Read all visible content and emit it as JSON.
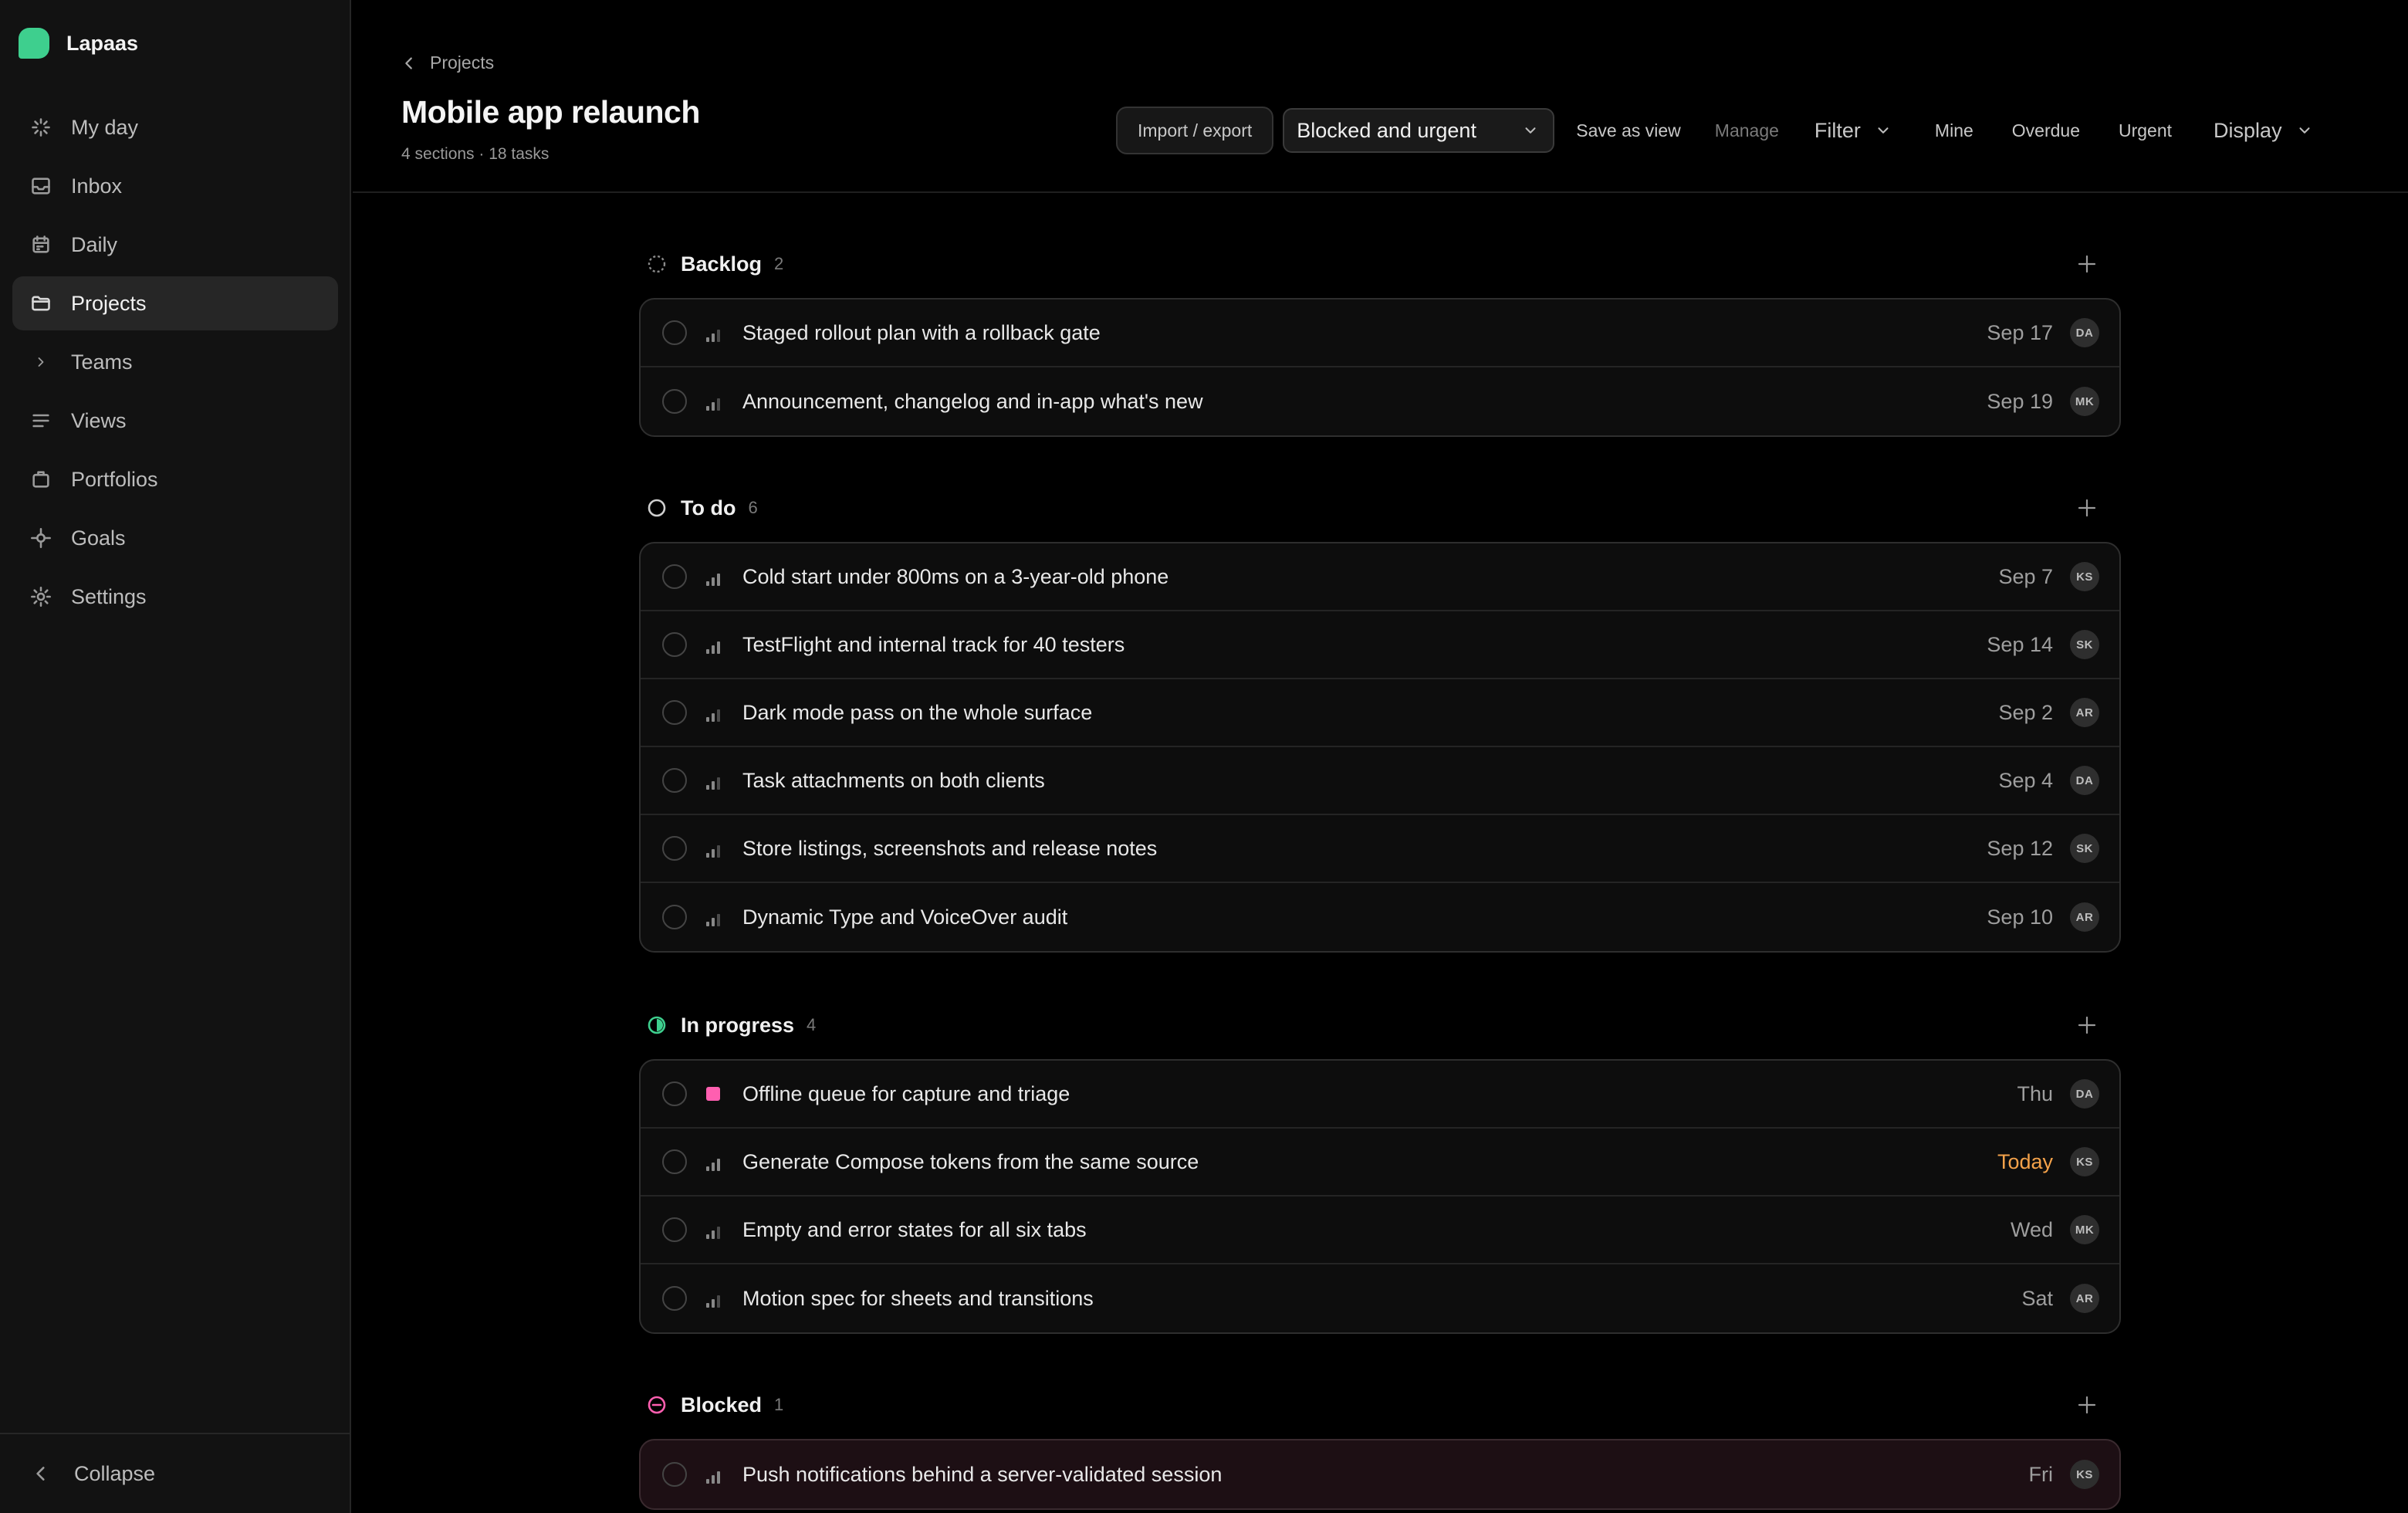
{
  "app": {
    "name": "Lapaas",
    "brand_color": "#3ecf8e"
  },
  "sidebar": {
    "items": [
      {
        "label": "My day",
        "icon": "sparkle-icon",
        "active": false
      },
      {
        "label": "Inbox",
        "icon": "inbox-icon",
        "active": false
      },
      {
        "label": "Daily",
        "icon": "calendar-icon",
        "active": false
      },
      {
        "label": "Projects",
        "icon": "folder-icon",
        "active": true
      },
      {
        "label": "Teams",
        "icon": "chevron-right-icon",
        "active": false
      },
      {
        "label": "Views",
        "icon": "list-icon",
        "active": false
      },
      {
        "label": "Portfolios",
        "icon": "briefcase-icon",
        "active": false
      },
      {
        "label": "Goals",
        "icon": "target-icon",
        "active": false
      },
      {
        "label": "Settings",
        "icon": "gear-icon",
        "active": false
      }
    ],
    "collapse_label": "Collapse"
  },
  "header": {
    "breadcrumb": "Projects",
    "title": "Mobile app relaunch",
    "subtitle": "4 sections · 18 tasks",
    "toolbar": {
      "import_export": "Import / export",
      "view_select": "Blocked and urgent",
      "save_as_view": "Save as view",
      "manage": "Manage",
      "filter": "Filter",
      "mine": "Mine",
      "overdue": "Overdue",
      "urgent": "Urgent",
      "display": "Display"
    }
  },
  "sections": [
    {
      "title": "Backlog",
      "count": "2",
      "status": "backlog",
      "tasks": [
        {
          "title": "Staged rollout plan with a rollback gate",
          "due": "Sep 17",
          "assignee": "DA",
          "priority": "low"
        },
        {
          "title": "Announcement, changelog and in-app what's new",
          "due": "Sep 19",
          "assignee": "MK",
          "priority": "low"
        }
      ]
    },
    {
      "title": "To do",
      "count": "6",
      "status": "todo",
      "tasks": [
        {
          "title": "Cold start under 800ms on a 3-year-old phone",
          "due": "Sep 7",
          "assignee": "KS",
          "priority": "high"
        },
        {
          "title": "TestFlight and internal track for 40 testers",
          "due": "Sep 14",
          "assignee": "SK",
          "priority": "high"
        },
        {
          "title": "Dark mode pass on the whole surface",
          "due": "Sep 2",
          "assignee": "AR",
          "priority": "medium"
        },
        {
          "title": "Task attachments on both clients",
          "due": "Sep 4",
          "assignee": "DA",
          "priority": "medium"
        },
        {
          "title": "Store listings, screenshots and release notes",
          "due": "Sep 12",
          "assignee": "SK",
          "priority": "medium"
        },
        {
          "title": "Dynamic Type and VoiceOver audit",
          "due": "Sep 10",
          "assignee": "AR",
          "priority": "low"
        }
      ]
    },
    {
      "title": "In progress",
      "count": "4",
      "status": "in-progress",
      "tasks": [
        {
          "title": "Offline queue for capture and triage",
          "due": "Thu",
          "assignee": "DA",
          "priority": "urgent"
        },
        {
          "title": "Generate Compose tokens from the same source",
          "due": "Today",
          "assignee": "KS",
          "priority": "high"
        },
        {
          "title": "Empty and error states for all six tabs",
          "due": "Wed",
          "assignee": "MK",
          "priority": "medium"
        },
        {
          "title": "Motion spec for sheets and transitions",
          "due": "Sat",
          "assignee": "AR",
          "priority": "low"
        }
      ]
    },
    {
      "title": "Blocked",
      "count": "1",
      "status": "blocked",
      "tasks": [
        {
          "title": "Push notifications behind a server-validated session",
          "due": "Fri",
          "assignee": "KS",
          "priority": "high"
        }
      ]
    }
  ],
  "colors": {
    "in_progress": "#3ecf8e",
    "blocked": "#ff5fb0",
    "today": "#f4a24a",
    "urgent": "#ff5fb0"
  }
}
